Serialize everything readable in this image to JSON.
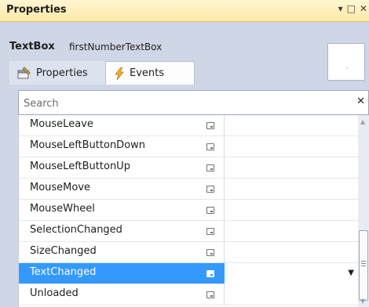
{
  "window": {
    "title": "Properties",
    "icons": [
      "dropdown-icon",
      "maximize-icon",
      "close-icon"
    ]
  },
  "header": {
    "object_type": "TextBox",
    "object_name": "firstNumberTextBox"
  },
  "tabs": [
    {
      "label": "Properties",
      "icon": "properties-icon",
      "active": false
    },
    {
      "label": "Events",
      "icon": "lightning-icon",
      "active": true
    }
  ],
  "search": {
    "placeholder": "Search",
    "value": ""
  },
  "events": [
    {
      "name": "MouseLeave",
      "handler": "",
      "selected": false
    },
    {
      "name": "MouseLeftButtonDown",
      "handler": "",
      "selected": false
    },
    {
      "name": "MouseLeftButtonUp",
      "handler": "",
      "selected": false
    },
    {
      "name": "MouseMove",
      "handler": "",
      "selected": false
    },
    {
      "name": "MouseWheel",
      "handler": "",
      "selected": false
    },
    {
      "name": "SelectionChanged",
      "handler": "",
      "selected": false
    },
    {
      "name": "SizeChanged",
      "handler": "",
      "selected": false
    },
    {
      "name": "TextChanged",
      "handler": "",
      "selected": true
    },
    {
      "name": "Unloaded",
      "handler": "",
      "selected": false
    }
  ],
  "colors": {
    "selection": "#3399ff",
    "title_bar": "#ffe8a6",
    "panel_background": "#cfd6e5"
  }
}
